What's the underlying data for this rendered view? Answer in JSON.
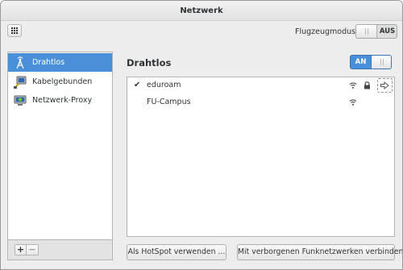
{
  "window": {
    "title": "Netzwerk"
  },
  "toolbar": {
    "airplane_label": "Flugzeugmodus",
    "airplane_state": "AUS"
  },
  "sidebar": {
    "items": [
      {
        "label": "Drahtlos",
        "icon": "wireless-tower-icon",
        "selected": true
      },
      {
        "label": "Kabelgebunden",
        "icon": "wired-network-icon",
        "selected": false
      },
      {
        "label": "Netzwerk-Proxy",
        "icon": "network-proxy-icon",
        "selected": false
      }
    ],
    "add_label": "+",
    "remove_label": "−"
  },
  "main": {
    "title": "Drahtlos",
    "wifi_state": "AN",
    "networks": [
      {
        "name": "eduroam",
        "connected": true,
        "secured": true,
        "check": "✔"
      },
      {
        "name": "FU-Campus",
        "connected": false,
        "secured": false,
        "check": ""
      }
    ],
    "hotspot_button": "Als HotSpot verwenden ...",
    "hidden_button": "Mit verborgenen Funknetzwerken verbinden"
  },
  "colors": {
    "accent": "#4a90d9",
    "window_bg": "#ededed"
  }
}
